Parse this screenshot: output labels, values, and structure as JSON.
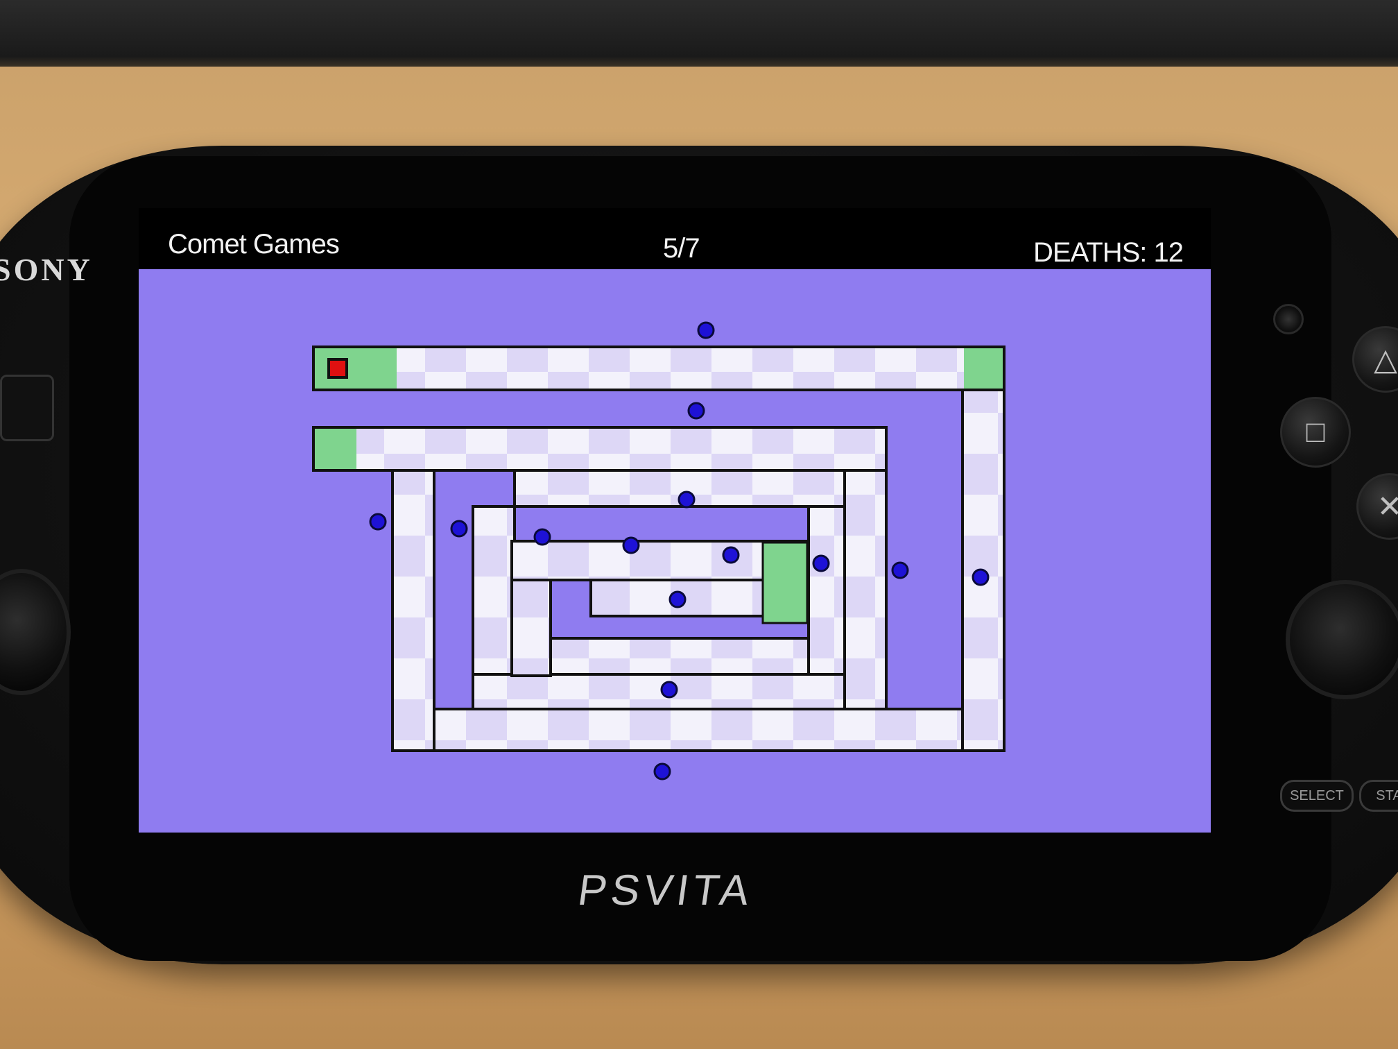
{
  "device": {
    "brand": "SONY",
    "model_logo": "PSVITA",
    "select_label": "SELECT",
    "start_label": "STA"
  },
  "hud": {
    "title": "Comet Games",
    "level": "5/7",
    "deaths": "DEATHS: 12"
  },
  "colors": {
    "background": "#8f7cf0",
    "tile_light": "#f2f2fb",
    "tile_dark": "#dcd6f6",
    "safe_zone": "#7fd48e",
    "player": "#e01010",
    "enemy": "#1e12d6",
    "wall": "#111111"
  },
  "icons": {
    "triangle": "triangle-icon",
    "square": "square-icon",
    "cross": "cross-icon"
  },
  "game": {
    "player": {
      "state": "alive"
    },
    "enemy_count": 14
  }
}
